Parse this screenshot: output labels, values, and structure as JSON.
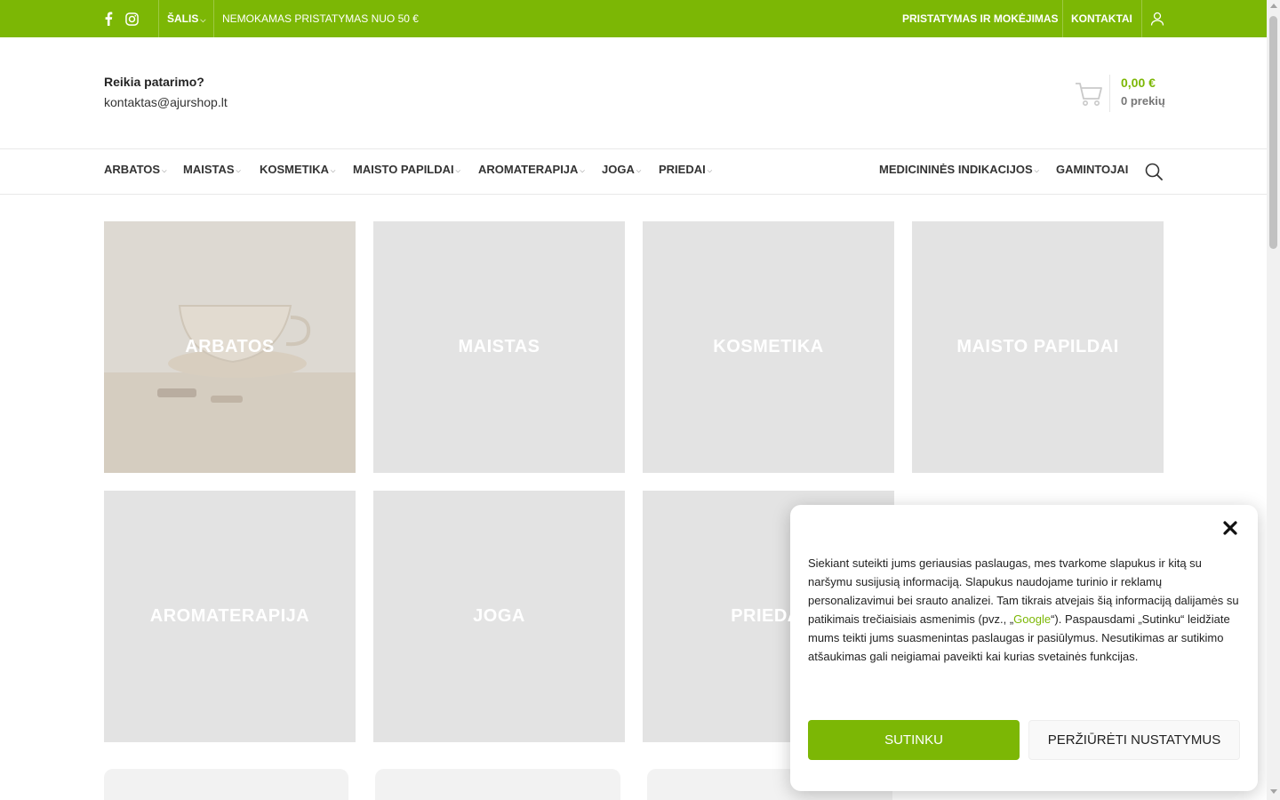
{
  "topbar": {
    "country_label": "ŠALIS",
    "promo": "NEMOKAMAS PRISTATYMAS NUO 50 €",
    "links": [
      "PRISTATYMAS IR MOKĖJIMAS",
      "KONTAKTAI"
    ],
    "bg_color": "#7cb705",
    "icons": [
      "facebook-icon",
      "instagram-icon",
      "user-icon"
    ]
  },
  "header": {
    "advice_title": "Reikia patarimo?",
    "advice_email": "kontaktas@ajurshop.lt",
    "cart_total": "0,00 €",
    "cart_count": "0 prekių"
  },
  "nav": {
    "items": [
      "ARBATOS",
      "MAISTAS",
      "KOSMETIKA",
      "MAISTO PAPILDAI",
      "AROMATERAPIJA",
      "JOGA",
      "PRIEDAI"
    ],
    "right_items": [
      "MEDICININĖS INDIKACIJOS",
      "GAMINTOJAI"
    ]
  },
  "categories": [
    "ARBATOS",
    "MAISTAS",
    "KOSMETIKA",
    "MAISTO PAPILDAI",
    "AROMATERAPIJA",
    "JOGA",
    "PRIEDAI"
  ],
  "cookie": {
    "text_before_link": "Siekiant suteikti jums geriausias paslaugas, mes tvarkome slapukus ir kitą su naršymu susijusią informaciją. Slapukus naudojame turinio ir reklamų personalizavimui bei srauto analizei. Tam tikrais atvejais šią informaciją dalijamės su patikimais trečiaisiais asmenimis (pvz., „",
    "link_text": "Google",
    "text_after_link": "“). Paspausdami „Sutinku“ leidžiate mums teikti jums suasmenintas paslaugas ir pasiūlymus. Nesutikimas ar sutikimo atšaukimas gali neigiamai paveikti kai kurias svetainės funkcijas.",
    "accept_label": "SUTINKU",
    "settings_label": "PERŽIŪRĖTI NUSTATYMUS"
  },
  "accent_color": "#7cb705"
}
